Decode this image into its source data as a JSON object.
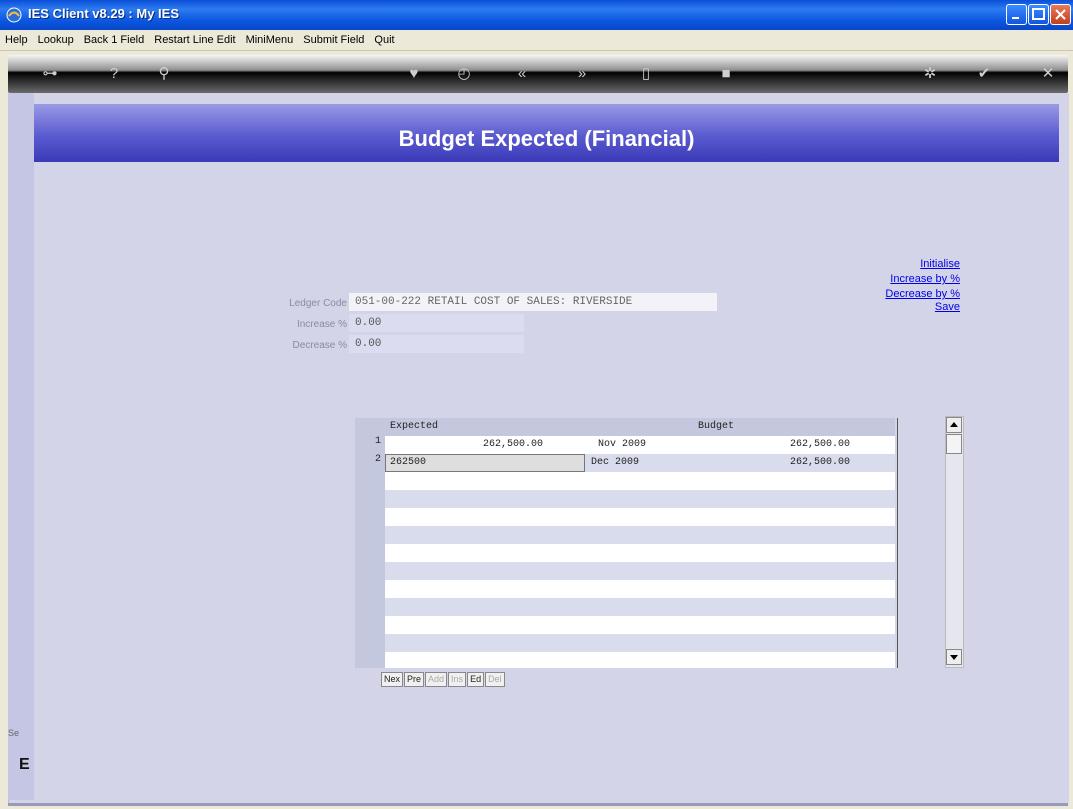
{
  "window": {
    "title": "IES Client v8.29 : My IES"
  },
  "menu": [
    "Help",
    "Lookup",
    "Back 1 Field",
    "Restart Line Edit",
    "MiniMenu",
    "Submit Field",
    "Quit"
  ],
  "toolbar": {
    "tools": [
      {
        "name": "key-icon",
        "glyph": "⊶"
      },
      {
        "name": "help-icon",
        "glyph": "?"
      },
      {
        "name": "search-icon",
        "glyph": "⚲"
      },
      {
        "name": "heart-icon",
        "glyph": "♥"
      },
      {
        "name": "clock-icon",
        "glyph": "◴"
      },
      {
        "name": "rewind-icon",
        "glyph": "«"
      },
      {
        "name": "forward-icon",
        "glyph": "»"
      },
      {
        "name": "document-icon",
        "glyph": "▯"
      },
      {
        "name": "stop-icon",
        "glyph": "■"
      },
      {
        "name": "gear-icon",
        "glyph": "✲"
      },
      {
        "name": "check-icon",
        "glyph": "✔"
      },
      {
        "name": "close-icon",
        "glyph": "✕"
      }
    ]
  },
  "page": {
    "heading": "Budget Expected (Financial)"
  },
  "links": {
    "initialise": "Initialise",
    "increase": "Increase by %",
    "decrease": "Decrease by %",
    "save": "Save"
  },
  "fields": {
    "ledger_label": "Ledger Code",
    "ledger_value": "051-00-222 RETAIL COST OF SALES: RIVERSIDE",
    "increase_label": "Increase %",
    "increase_value": "0.00",
    "decrease_label": "Decrease %",
    "decrease_value": "0.00"
  },
  "grid": {
    "headers": {
      "expected": "Expected",
      "budget": "Budget"
    },
    "rows": [
      {
        "num": "1",
        "expected": "262,500.00",
        "period": "Nov 2009",
        "budget": "262,500.00"
      },
      {
        "num": "2",
        "expected": "262500",
        "period": "Dec 2009",
        "budget": "262,500.00"
      }
    ],
    "buttons": [
      "Nex",
      "Pre",
      "Add",
      "Ins",
      "Ed",
      "Del"
    ],
    "disabled_buttons": [
      "Add",
      "Ins",
      "Del"
    ]
  },
  "status": {
    "text": "Se",
    "icon": "E"
  }
}
